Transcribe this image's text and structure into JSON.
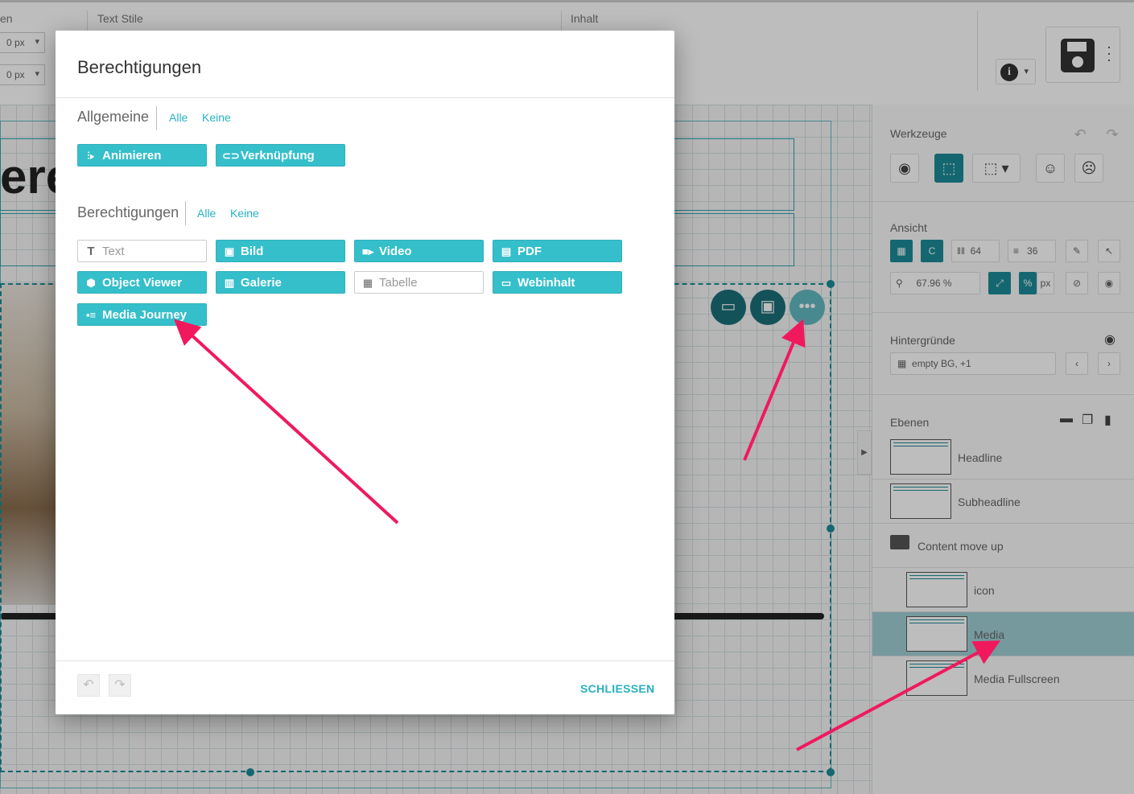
{
  "toolbar": {
    "section_partial": "en",
    "section_text_styles": "Text Stile",
    "section_content": "Inhalt",
    "px_value_1": "0 px",
    "px_value_2": "0 px",
    "info_icon": "i"
  },
  "canvas": {
    "headline_fragment": "ere"
  },
  "sidebar": {
    "tools": {
      "title": "Werkzeuge"
    },
    "view": {
      "title": "Ansicht",
      "columns": "64",
      "rows": "36",
      "zoom": "67.96 %",
      "unit_percent": "%",
      "unit_px": "px"
    },
    "backgrounds": {
      "title": "Hintergründe",
      "value": "empty BG, +1"
    },
    "layers": {
      "title": "Ebenen",
      "items": [
        {
          "name": "Headline"
        },
        {
          "name": "Subheadline"
        },
        {
          "name": "Content move up"
        },
        {
          "name": "icon"
        },
        {
          "name": "Media"
        },
        {
          "name": "Media Fullscreen"
        }
      ]
    }
  },
  "dialog": {
    "title": "Berechtigungen",
    "general": {
      "label": "Allgemeine",
      "all": "Alle",
      "none": "Keine",
      "items": [
        {
          "label": "Animieren",
          "icon": "animate-icon",
          "active": true
        },
        {
          "label": "Verknüpfung",
          "icon": "link-icon",
          "active": true
        }
      ]
    },
    "permissions": {
      "label": "Berechtigungen",
      "all": "Alle",
      "none": "Keine",
      "items": [
        {
          "label": "Text",
          "icon": "text-icon",
          "active": false
        },
        {
          "label": "Bild",
          "icon": "image-icon",
          "active": true
        },
        {
          "label": "Video",
          "icon": "video-icon",
          "active": true
        },
        {
          "label": "PDF",
          "icon": "pdf-icon",
          "active": true
        },
        {
          "label": "Object Viewer",
          "icon": "cube-icon",
          "active": true
        },
        {
          "label": "Galerie",
          "icon": "gallery-icon",
          "active": true
        },
        {
          "label": "Tabelle",
          "icon": "table-icon",
          "active": false
        },
        {
          "label": "Webinhalt",
          "icon": "web-icon",
          "active": true
        },
        {
          "label": "Media Journey",
          "icon": "media-journey-icon",
          "active": true
        }
      ]
    },
    "close_label": "SCHLIESSEN"
  },
  "colors": {
    "accent": "#35bfca",
    "accent_dark": "#1b8b98",
    "annotation_arrow": "#f0195e"
  }
}
